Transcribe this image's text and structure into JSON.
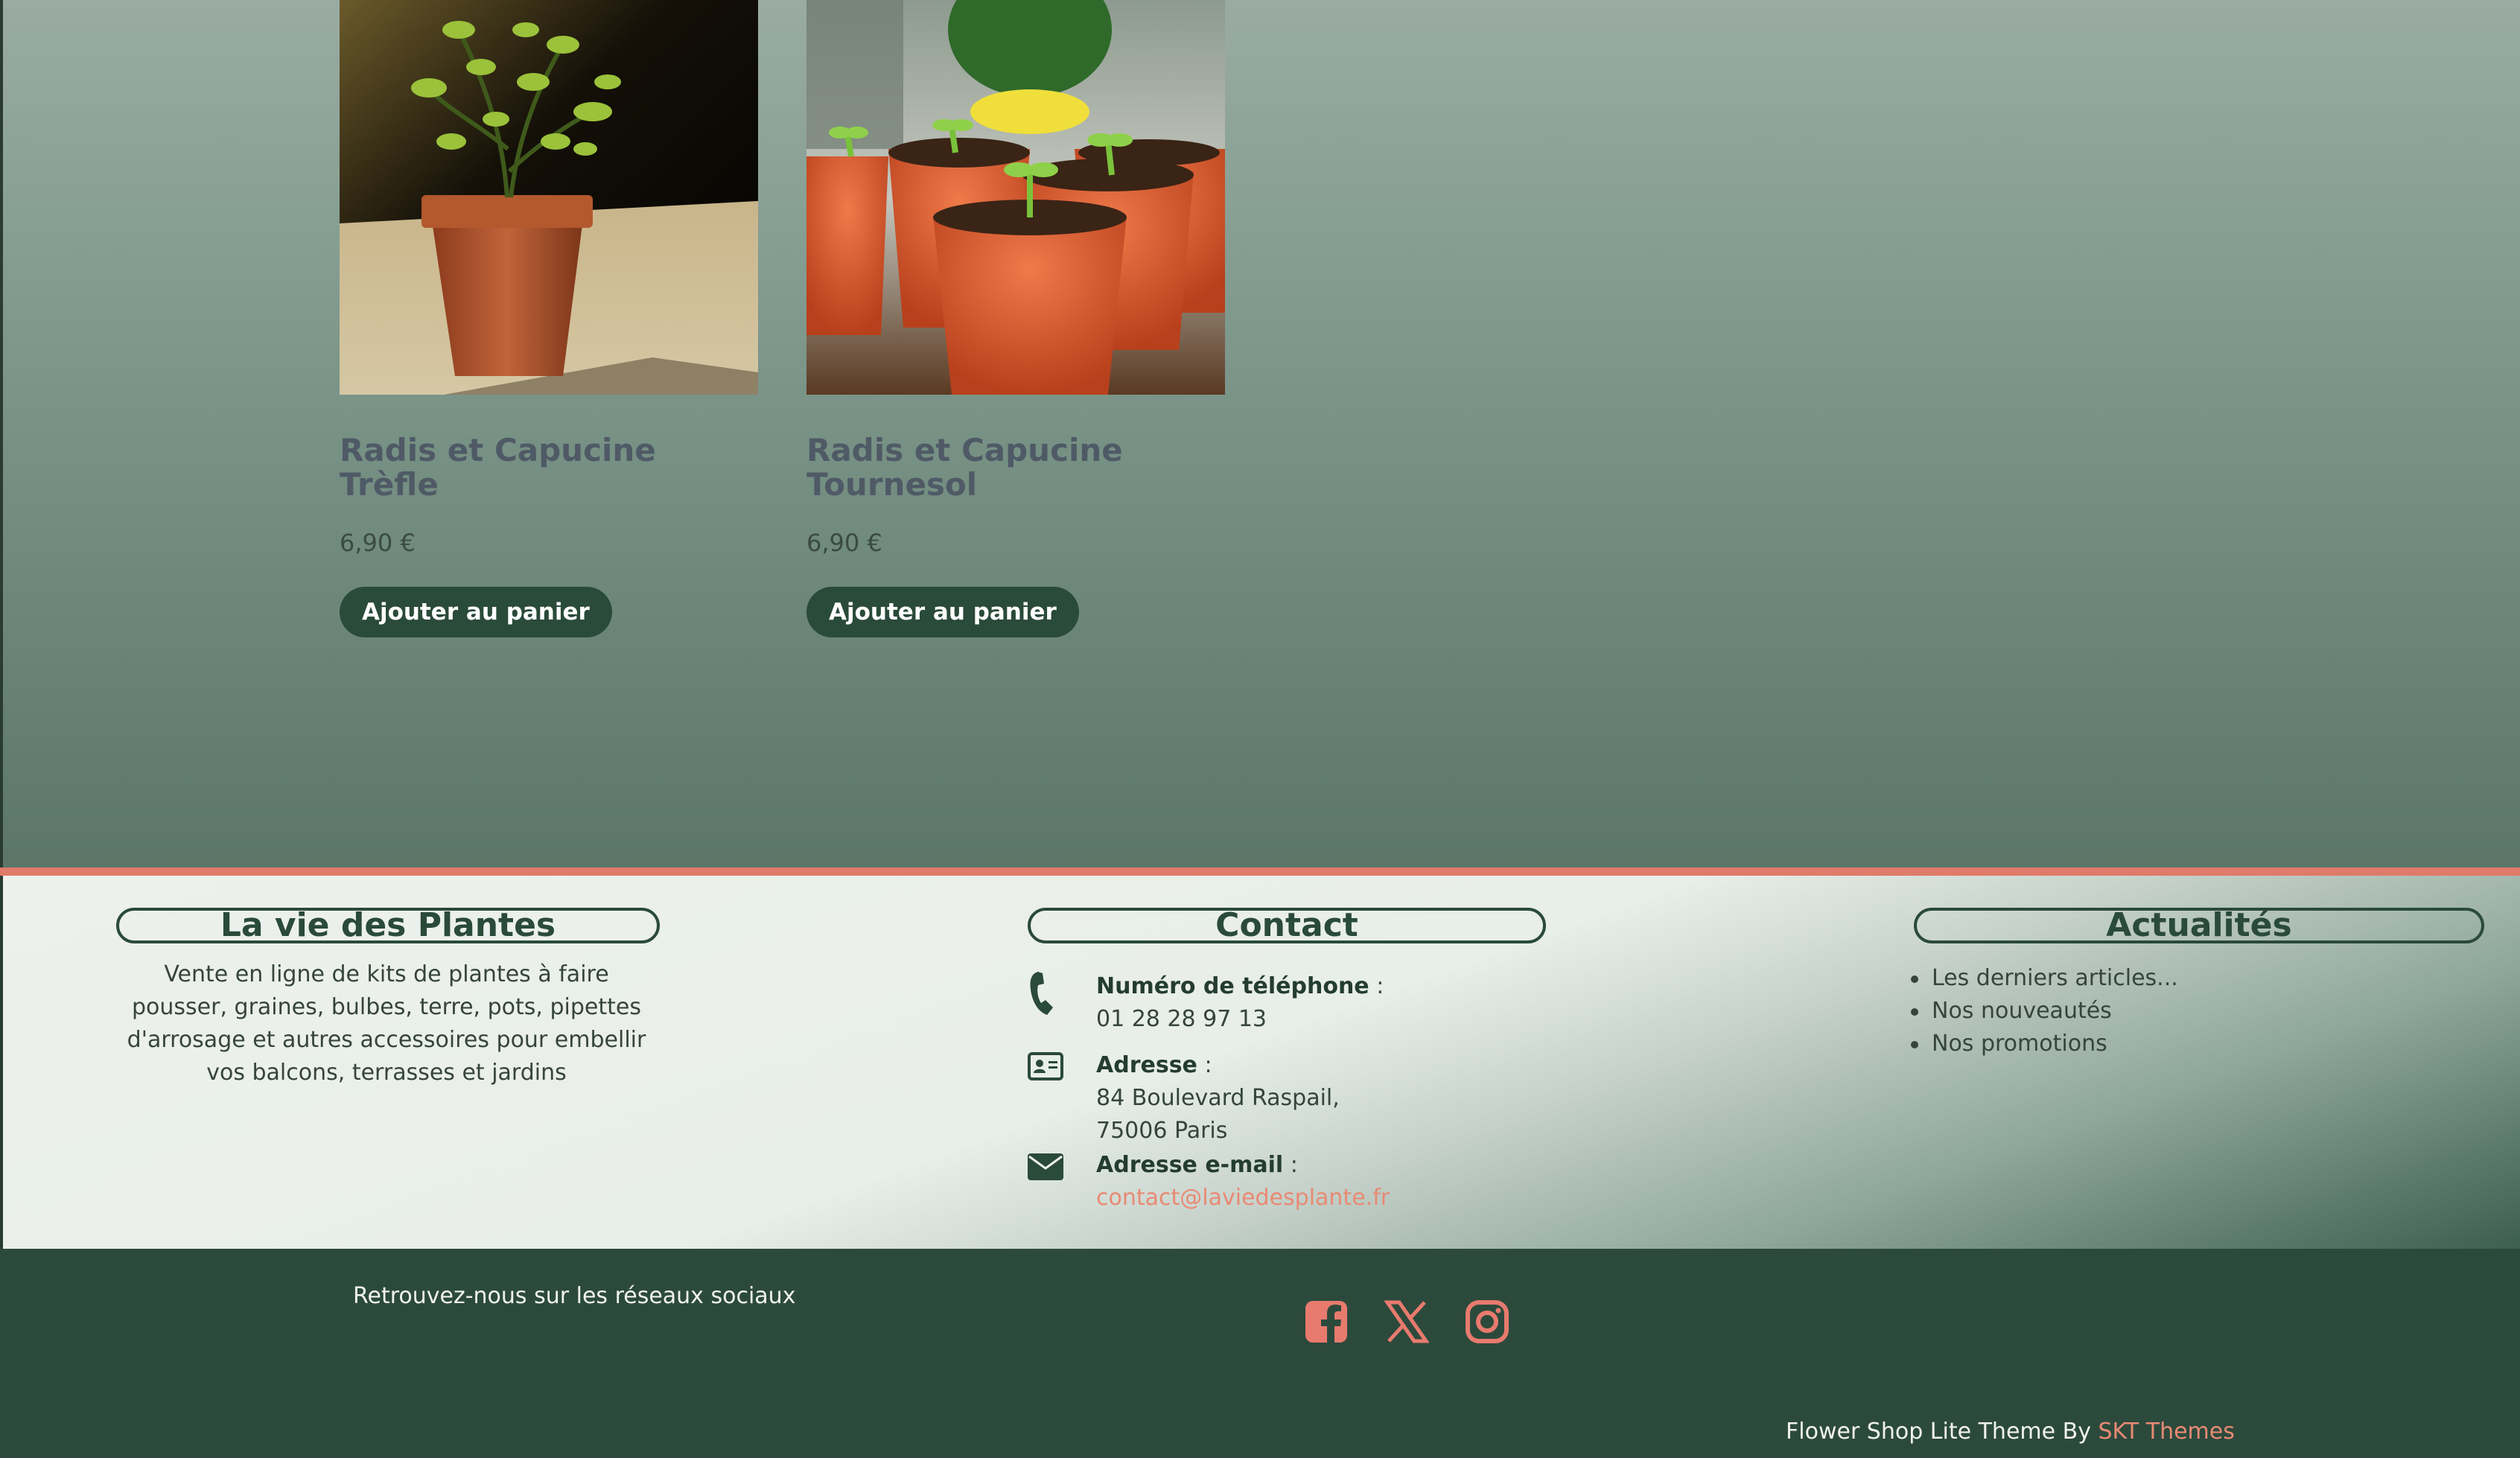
{
  "products": [
    {
      "title": "Radis et Capucine Trèfle",
      "price": "6,90 €",
      "button": "Ajouter au panier"
    },
    {
      "title": "Radis et Capucine Tournesol",
      "price": "6,90 €",
      "button": "Ajouter au panier"
    }
  ],
  "footer": {
    "about": {
      "title": "La vie des Plantes",
      "text": "Vente en ligne de kits de plantes à faire pousser, graines, bulbes, terre, pots, pipettes d'arrosage et autres accessoires pour embellir vos balcons, terrasses et jardins"
    },
    "contact": {
      "title": "Contact",
      "phone_label": "Numéro de téléphone",
      "phone": "01 28 28 97 13",
      "address_label": "Adresse",
      "address_line1": "84 Boulevard Raspail,",
      "address_line2": "75006 Paris",
      "email_label": "Adresse e-mail",
      "email": "contact@laviedesplante.fr"
    },
    "news": {
      "title": "Actualités",
      "items": [
        "Les derniers articles...",
        "Nos nouveautés",
        "Nos promotions"
      ]
    }
  },
  "bottom": {
    "social_text": "Retrouvez-nous sur les réseaux sociaux",
    "social_icons": [
      "facebook-icon",
      "x-icon",
      "instagram-icon"
    ],
    "credit_text": "Flower Shop Lite Theme By ",
    "credit_link": "SKT Themes"
  },
  "colors": {
    "accent": "#e88a74",
    "dark_green": "#2c4a3c",
    "button": "#2a4a3a"
  }
}
